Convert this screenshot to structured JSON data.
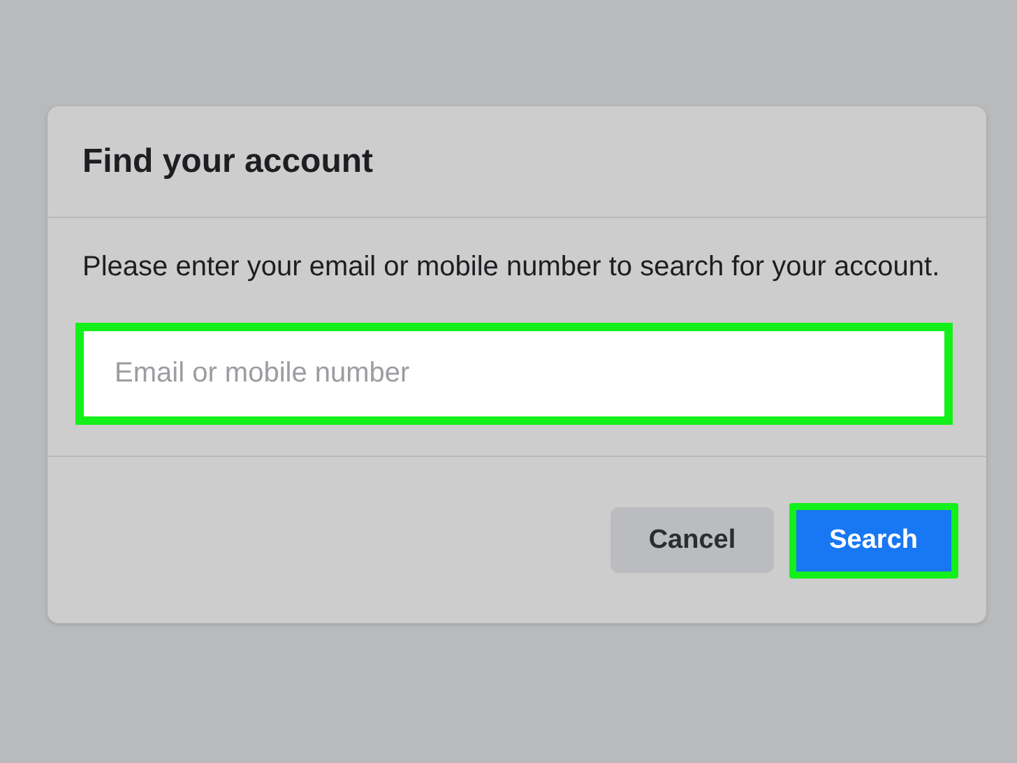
{
  "dialog": {
    "title": "Find your account",
    "message": "Please enter your email or mobile number to search for your account.",
    "field": {
      "placeholder": "Email or mobile number",
      "highlighted": true
    },
    "buttons": [
      {
        "label": "Cancel",
        "kind": "secondary",
        "highlighted": false
      },
      {
        "label": "Search",
        "kind": "primary",
        "highlighted": true
      }
    ]
  }
}
